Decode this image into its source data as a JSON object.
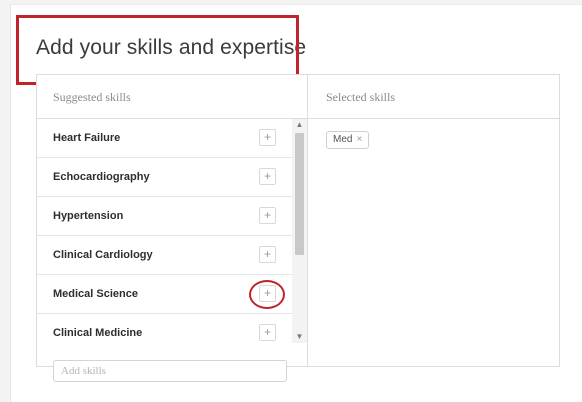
{
  "page": {
    "title": "Add your skills and expertise"
  },
  "suggested": {
    "header": "Suggested skills",
    "add_symbol": "+",
    "items": [
      {
        "label": "Heart Failure"
      },
      {
        "label": "Echocardiography"
      },
      {
        "label": "Hypertension"
      },
      {
        "label": "Clinical Cardiology"
      },
      {
        "label": "Medical Science"
      },
      {
        "label": "Clinical Medicine"
      }
    ],
    "input": {
      "placeholder": "Add skills",
      "value": ""
    }
  },
  "selected": {
    "header": "Selected skills",
    "chips": [
      {
        "label": "Med",
        "remove": "×"
      }
    ]
  },
  "scroll": {
    "up": "▲",
    "down": "▼"
  },
  "colors": {
    "highlight": "#c0242b"
  }
}
